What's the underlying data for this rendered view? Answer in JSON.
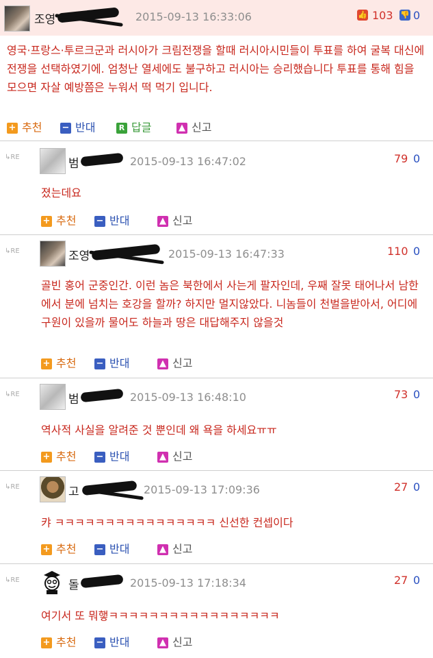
{
  "post": {
    "author": "조영",
    "date": "2015-09-13 16:33:06",
    "up": "103",
    "down": "0",
    "body": "영국·프랑스·투르크군과 러시아가 크림전쟁을 할때 러시아시민들이 투표를 하여 굴복 대신에 전쟁을 선택하였기에. 엄청난 열세에도 불구하고 러시아는 승리했습니다 투표를 통해 힘을 모으면 자살 예방쯤은 누워서 떡 먹기 입니다.",
    "actions": {
      "recommend": "추천",
      "oppose": "반대",
      "reply": "답글",
      "report": "신고"
    }
  },
  "re_label": "↳RE",
  "comments": [
    {
      "author": "범",
      "date": "2015-09-13 16:47:02",
      "up": "79",
      "down": "0",
      "body": "졌는데요",
      "actions": {
        "recommend": "추천",
        "oppose": "반대",
        "report": "신고"
      }
    },
    {
      "author": "조영",
      "date": "2015-09-13 16:47:33",
      "up": "110",
      "down": "0",
      "body": "골빈 홍어 군중인간. 이런 놈은 북한에서 사는게 팔자인데, 우째 잘못 태어나서 남한에서 분에 넘치는 호강을 할까? 하지만 멀지않았다. 니놈들이 천벌을받아서, 어디에 구원이 있을까 물어도 하늘과 땅은 대답해주지 않을것",
      "actions": {
        "recommend": "추천",
        "oppose": "반대",
        "report": "신고"
      }
    },
    {
      "author": "범",
      "date": "2015-09-13 16:48:10",
      "up": "73",
      "down": "0",
      "body": "역사적 사실을 알려준 것 뿐인데 왜 욕을 하세요ㅠㅠ",
      "actions": {
        "recommend": "추천",
        "oppose": "반대",
        "report": "신고"
      }
    },
    {
      "author": "고",
      "date": "2015-09-13 17:09:36",
      "up": "27",
      "down": "0",
      "body": "캬 ㅋㅋㅋㅋㅋㅋㅋㅋㅋㅋㅋㅋㅋㅋㅋㅋ 신선한 컨셉이다",
      "actions": {
        "recommend": "추천",
        "oppose": "반대",
        "report": "신고"
      }
    },
    {
      "author": "돌",
      "date": "2015-09-13 17:18:34",
      "up": "27",
      "down": "0",
      "body": "여기서 또 뭐햏ㅋㅋㅋㅋㅋㅋㅋㅋㅋㅋㅋㅋㅋㅋㅋㅋㅋ",
      "actions": {
        "recommend": "추천",
        "oppose": "반대",
        "report": "신고"
      }
    }
  ],
  "icons": {
    "thumb_up": "thumbs-up-icon",
    "thumb_down": "thumbs-down-icon",
    "plus": "plus-icon",
    "minus": "minus-icon",
    "reply": "reply-icon",
    "report": "report-icon"
  }
}
